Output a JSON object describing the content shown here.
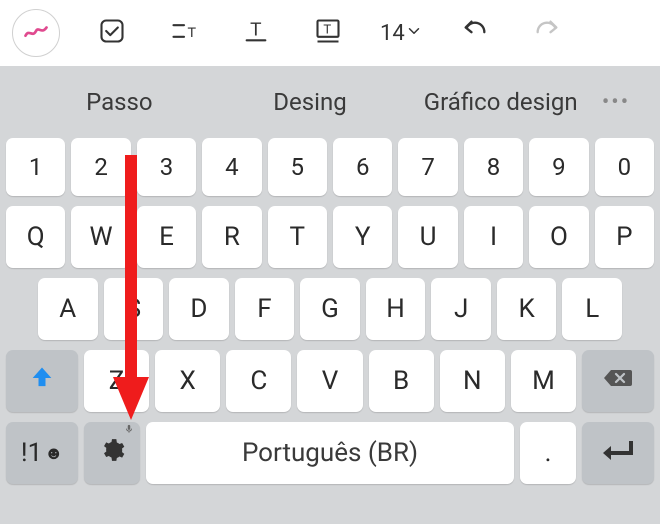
{
  "toolbar": {
    "font_size": "14"
  },
  "suggestions": {
    "items": [
      "Passo",
      "Desing",
      "Gráfico design"
    ]
  },
  "keyboard": {
    "row_numbers": [
      "1",
      "2",
      "3",
      "4",
      "5",
      "6",
      "7",
      "8",
      "9",
      "0"
    ],
    "row_q": [
      "Q",
      "W",
      "E",
      "R",
      "T",
      "Y",
      "U",
      "I",
      "O",
      "P"
    ],
    "row_a": [
      "A",
      "S",
      "D",
      "F",
      "G",
      "H",
      "J",
      "K",
      "L"
    ],
    "row_z": [
      "Z",
      "X",
      "C",
      "V",
      "B",
      "N",
      "M"
    ],
    "symbol_key": "!1",
    "space_label": "Português (BR)",
    "period": "."
  }
}
